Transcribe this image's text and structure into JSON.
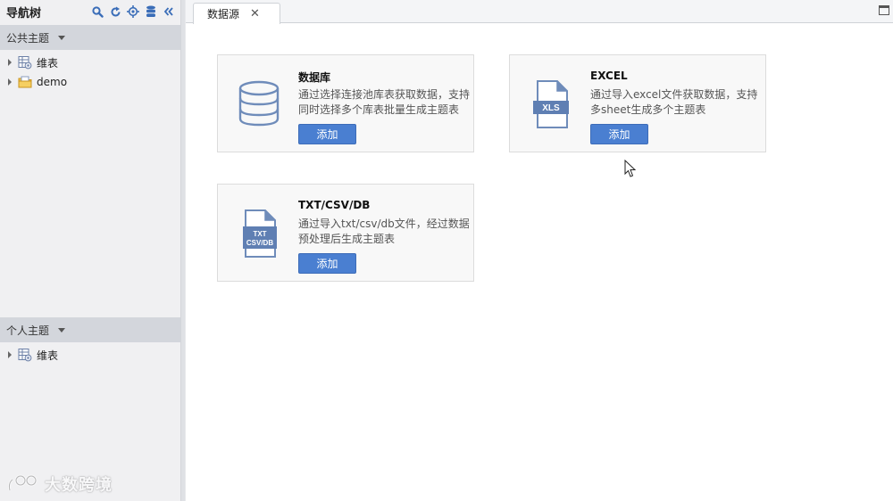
{
  "sidebar": {
    "title": "导航树",
    "tools": [
      "search-icon",
      "refresh-icon",
      "locate-icon",
      "database-icon",
      "collapse-icon"
    ],
    "public_group": {
      "label": "公共主题",
      "items": [
        {
          "label": "维表",
          "icon": "table-gear-icon"
        },
        {
          "label": "demo",
          "icon": "folder-icon"
        }
      ]
    },
    "personal_group": {
      "label": "个人主题",
      "items": [
        {
          "label": "维表",
          "icon": "table-gear-icon"
        }
      ]
    },
    "watermark": "大数跨境"
  },
  "tabs": [
    {
      "label": "数据源",
      "close": "✕",
      "active": true
    }
  ],
  "cards": [
    {
      "title": "数据库",
      "description": "通过选择连接池库表获取数据，支持同时选择多个库表批量生成主题表",
      "button": "添加",
      "icon": "database-icon"
    },
    {
      "title": "EXCEL",
      "description": "通过导入excel文件获取数据，支持多sheet生成多个主题表",
      "button": "添加",
      "icon": "xls-file-icon",
      "icon_label": "XLS"
    },
    {
      "title": "TXT/CSV/DB",
      "description": "通过导入txt/csv/db文件，经过数据预处理后生成主题表",
      "button": "添加",
      "icon": "txt-csv-db-file-icon",
      "icon_label_1": "TXT",
      "icon_label_2": "CSV/DB"
    }
  ],
  "colors": {
    "accent": "#4a7fd1",
    "icon": "#6f8cba",
    "sidebar_bg": "#f0f0f2",
    "group_header_bg": "#d3d6dc"
  }
}
